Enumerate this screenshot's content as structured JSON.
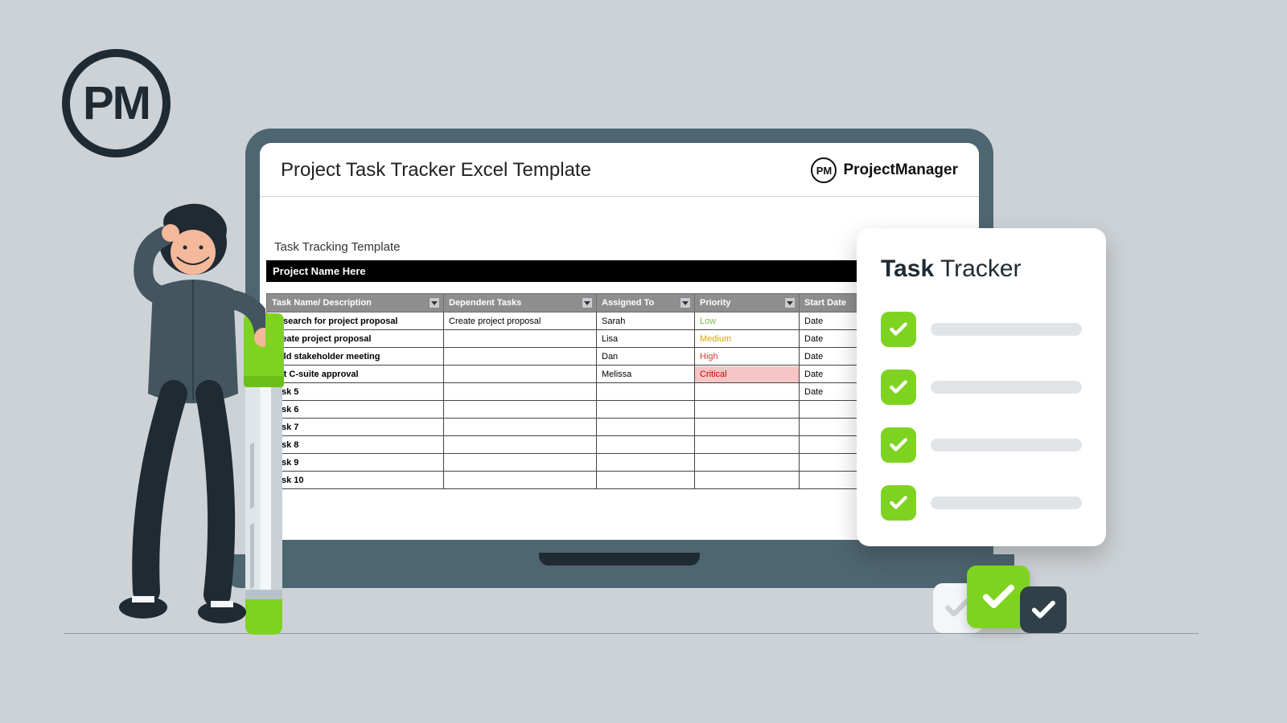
{
  "logo": {
    "text": "PM"
  },
  "header": {
    "title": "Project Task Tracker Excel Template",
    "brand_initials": "PM",
    "brand_name": "ProjectManager"
  },
  "sheet": {
    "subheading": "Task Tracking Template",
    "project_name": "Project Name Here",
    "columns": {
      "task": "Task Name/ Description",
      "dependent": "Dependent Tasks",
      "assigned": "Assigned To",
      "priority": "Priority",
      "start": "Start Date"
    },
    "rows": [
      {
        "task": "Research for project proposal",
        "dependent": "Create project proposal",
        "assigned": "Sarah",
        "priority": "Low",
        "priority_class": "pri-low",
        "start": "Date"
      },
      {
        "task": "Create project proposal",
        "dependent": "",
        "assigned": "Lisa",
        "priority": "Medium",
        "priority_class": "pri-med",
        "start": "Date"
      },
      {
        "task": "Hold stakeholder meeting",
        "dependent": "",
        "assigned": "Dan",
        "priority": "High",
        "priority_class": "pri-high",
        "start": "Date"
      },
      {
        "task": "Get C-suite approval",
        "dependent": "",
        "assigned": "Melissa",
        "priority": "Critical",
        "priority_class": "pri-crit",
        "start": "Date"
      },
      {
        "task": "Task 5",
        "dependent": "",
        "assigned": "",
        "priority": "",
        "priority_class": "",
        "start": "Date"
      },
      {
        "task": "Task 6",
        "dependent": "",
        "assigned": "",
        "priority": "",
        "priority_class": "",
        "start": ""
      },
      {
        "task": "Task 7",
        "dependent": "",
        "assigned": "",
        "priority": "",
        "priority_class": "",
        "start": ""
      },
      {
        "task": "Task 8",
        "dependent": "",
        "assigned": "",
        "priority": "",
        "priority_class": "",
        "start": ""
      },
      {
        "task": "Task 9",
        "dependent": "",
        "assigned": "",
        "priority": "",
        "priority_class": "",
        "start": ""
      },
      {
        "task": "Task 10",
        "dependent": "",
        "assigned": "",
        "priority": "",
        "priority_class": "",
        "start": ""
      }
    ]
  },
  "card": {
    "title_bold": "Task",
    "title_rest": " Tracker",
    "items": 4
  },
  "colors": {
    "accent_green": "#7ed321",
    "frame": "#4e6671",
    "dark": "#1f2a33"
  }
}
